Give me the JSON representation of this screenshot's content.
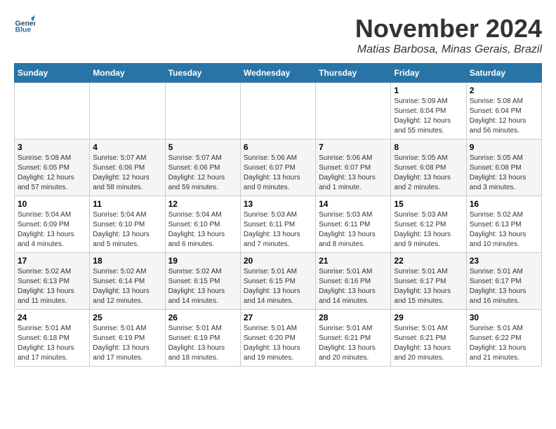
{
  "header": {
    "logo_line1": "General",
    "logo_line2": "Blue",
    "month_title": "November 2024",
    "subtitle": "Matias Barbosa, Minas Gerais, Brazil"
  },
  "days_of_week": [
    "Sunday",
    "Monday",
    "Tuesday",
    "Wednesday",
    "Thursday",
    "Friday",
    "Saturday"
  ],
  "weeks": [
    [
      {
        "day": "",
        "info": ""
      },
      {
        "day": "",
        "info": ""
      },
      {
        "day": "",
        "info": ""
      },
      {
        "day": "",
        "info": ""
      },
      {
        "day": "",
        "info": ""
      },
      {
        "day": "1",
        "info": "Sunrise: 5:09 AM\nSunset: 6:04 PM\nDaylight: 12 hours\nand 55 minutes."
      },
      {
        "day": "2",
        "info": "Sunrise: 5:08 AM\nSunset: 6:04 PM\nDaylight: 12 hours\nand 56 minutes."
      }
    ],
    [
      {
        "day": "3",
        "info": "Sunrise: 5:08 AM\nSunset: 6:05 PM\nDaylight: 12 hours\nand 57 minutes."
      },
      {
        "day": "4",
        "info": "Sunrise: 5:07 AM\nSunset: 6:06 PM\nDaylight: 12 hours\nand 58 minutes."
      },
      {
        "day": "5",
        "info": "Sunrise: 5:07 AM\nSunset: 6:06 PM\nDaylight: 12 hours\nand 59 minutes."
      },
      {
        "day": "6",
        "info": "Sunrise: 5:06 AM\nSunset: 6:07 PM\nDaylight: 13 hours\nand 0 minutes."
      },
      {
        "day": "7",
        "info": "Sunrise: 5:06 AM\nSunset: 6:07 PM\nDaylight: 13 hours\nand 1 minute."
      },
      {
        "day": "8",
        "info": "Sunrise: 5:05 AM\nSunset: 6:08 PM\nDaylight: 13 hours\nand 2 minutes."
      },
      {
        "day": "9",
        "info": "Sunrise: 5:05 AM\nSunset: 6:08 PM\nDaylight: 13 hours\nand 3 minutes."
      }
    ],
    [
      {
        "day": "10",
        "info": "Sunrise: 5:04 AM\nSunset: 6:09 PM\nDaylight: 13 hours\nand 4 minutes."
      },
      {
        "day": "11",
        "info": "Sunrise: 5:04 AM\nSunset: 6:10 PM\nDaylight: 13 hours\nand 5 minutes."
      },
      {
        "day": "12",
        "info": "Sunrise: 5:04 AM\nSunset: 6:10 PM\nDaylight: 13 hours\nand 6 minutes."
      },
      {
        "day": "13",
        "info": "Sunrise: 5:03 AM\nSunset: 6:11 PM\nDaylight: 13 hours\nand 7 minutes."
      },
      {
        "day": "14",
        "info": "Sunrise: 5:03 AM\nSunset: 6:11 PM\nDaylight: 13 hours\nand 8 minutes."
      },
      {
        "day": "15",
        "info": "Sunrise: 5:03 AM\nSunset: 6:12 PM\nDaylight: 13 hours\nand 9 minutes."
      },
      {
        "day": "16",
        "info": "Sunrise: 5:02 AM\nSunset: 6:13 PM\nDaylight: 13 hours\nand 10 minutes."
      }
    ],
    [
      {
        "day": "17",
        "info": "Sunrise: 5:02 AM\nSunset: 6:13 PM\nDaylight: 13 hours\nand 11 minutes."
      },
      {
        "day": "18",
        "info": "Sunrise: 5:02 AM\nSunset: 6:14 PM\nDaylight: 13 hours\nand 12 minutes."
      },
      {
        "day": "19",
        "info": "Sunrise: 5:02 AM\nSunset: 6:15 PM\nDaylight: 13 hours\nand 14 minutes."
      },
      {
        "day": "20",
        "info": "Sunrise: 5:01 AM\nSunset: 6:15 PM\nDaylight: 13 hours\nand 14 minutes."
      },
      {
        "day": "21",
        "info": "Sunrise: 5:01 AM\nSunset: 6:16 PM\nDaylight: 13 hours\nand 14 minutes."
      },
      {
        "day": "22",
        "info": "Sunrise: 5:01 AM\nSunset: 6:17 PM\nDaylight: 13 hours\nand 15 minutes."
      },
      {
        "day": "23",
        "info": "Sunrise: 5:01 AM\nSunset: 6:17 PM\nDaylight: 13 hours\nand 16 minutes."
      }
    ],
    [
      {
        "day": "24",
        "info": "Sunrise: 5:01 AM\nSunset: 6:18 PM\nDaylight: 13 hours\nand 17 minutes."
      },
      {
        "day": "25",
        "info": "Sunrise: 5:01 AM\nSunset: 6:19 PM\nDaylight: 13 hours\nand 17 minutes."
      },
      {
        "day": "26",
        "info": "Sunrise: 5:01 AM\nSunset: 6:19 PM\nDaylight: 13 hours\nand 18 minutes."
      },
      {
        "day": "27",
        "info": "Sunrise: 5:01 AM\nSunset: 6:20 PM\nDaylight: 13 hours\nand 19 minutes."
      },
      {
        "day": "28",
        "info": "Sunrise: 5:01 AM\nSunset: 6:21 PM\nDaylight: 13 hours\nand 20 minutes."
      },
      {
        "day": "29",
        "info": "Sunrise: 5:01 AM\nSunset: 6:21 PM\nDaylight: 13 hours\nand 20 minutes."
      },
      {
        "day": "30",
        "info": "Sunrise: 5:01 AM\nSunset: 6:22 PM\nDaylight: 13 hours\nand 21 minutes."
      }
    ]
  ]
}
